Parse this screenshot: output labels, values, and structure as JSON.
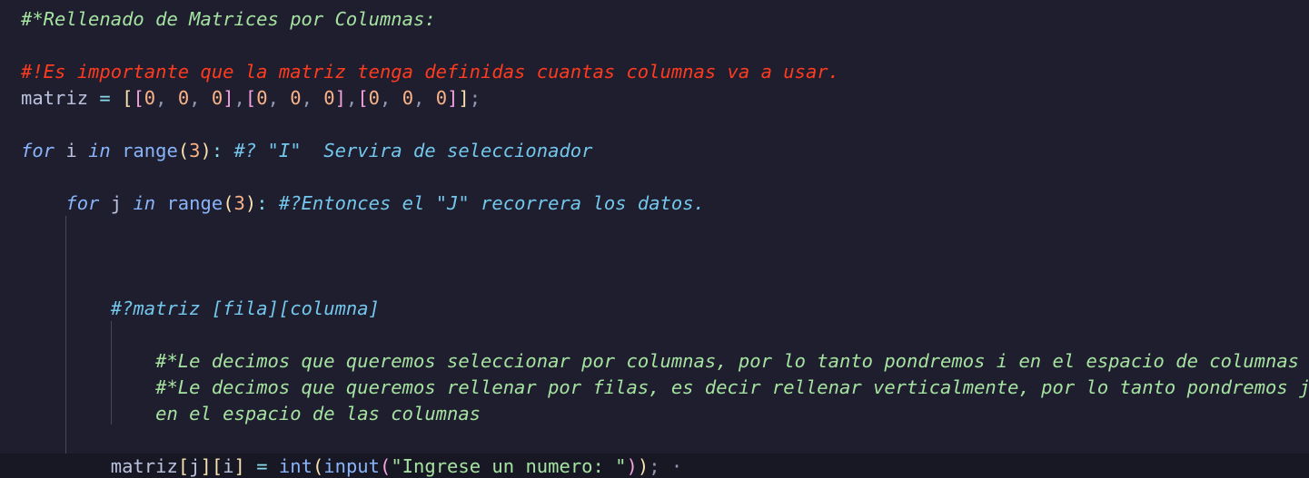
{
  "colors": {
    "background": "#1e1e2e",
    "current_line": "#181825",
    "indent_guide": "#45475a",
    "text": "#cdd6f4",
    "keyword": "#89b4fa",
    "variable": "#bac2de",
    "comment_green": "#a6e3a1",
    "comment_red": "#ff3b1f",
    "comment_blue": "#74c7ec",
    "number": "#fab387",
    "bracket_yellow": "#f9e2af",
    "bracket_pink": "#f5a3e0",
    "bracket_blue": "#89b4fa",
    "string": "#a6e3a1",
    "operator": "#89dceb",
    "function": "#89b4fa",
    "punct": "#9399b2"
  },
  "code": {
    "lines": [
      {
        "tokens": [
          {
            "t": "#*Rellenado de Matrices por Columnas:",
            "c": "comment_green",
            "i": true
          }
        ]
      },
      {
        "tokens": []
      },
      {
        "tokens": [
          {
            "t": "#!Es importante que la matriz tenga definidas cuantas columnas va a usar.",
            "c": "comment_red",
            "i": true
          }
        ]
      },
      {
        "tokens": [
          {
            "t": "matriz",
            "c": "variable"
          },
          {
            "t": " = ",
            "c": "operator"
          },
          {
            "t": "[",
            "c": "bracket_yellow"
          },
          {
            "t": "[",
            "c": "bracket_pink"
          },
          {
            "t": "0",
            "c": "number"
          },
          {
            "t": ", ",
            "c": "punct"
          },
          {
            "t": "0",
            "c": "number"
          },
          {
            "t": ", ",
            "c": "punct"
          },
          {
            "t": "0",
            "c": "number"
          },
          {
            "t": "]",
            "c": "bracket_pink"
          },
          {
            "t": ",",
            "c": "punct"
          },
          {
            "t": "[",
            "c": "bracket_pink"
          },
          {
            "t": "0",
            "c": "number"
          },
          {
            "t": ", ",
            "c": "punct"
          },
          {
            "t": "0",
            "c": "number"
          },
          {
            "t": ", ",
            "c": "punct"
          },
          {
            "t": "0",
            "c": "number"
          },
          {
            "t": "]",
            "c": "bracket_pink"
          },
          {
            "t": ",",
            "c": "punct"
          },
          {
            "t": "[",
            "c": "bracket_pink"
          },
          {
            "t": "0",
            "c": "number"
          },
          {
            "t": ", ",
            "c": "punct"
          },
          {
            "t": "0",
            "c": "number"
          },
          {
            "t": ", ",
            "c": "punct"
          },
          {
            "t": "0",
            "c": "number"
          },
          {
            "t": "]",
            "c": "bracket_pink"
          },
          {
            "t": "]",
            "c": "bracket_yellow"
          },
          {
            "t": ";",
            "c": "punct"
          }
        ]
      },
      {
        "tokens": []
      },
      {
        "tokens": [
          {
            "t": "for",
            "c": "keyword",
            "i": true
          },
          {
            "t": " i ",
            "c": "variable"
          },
          {
            "t": "in",
            "c": "keyword",
            "i": true
          },
          {
            "t": " range",
            "c": "function"
          },
          {
            "t": "(",
            "c": "bracket_yellow"
          },
          {
            "t": "3",
            "c": "number"
          },
          {
            "t": ")",
            "c": "bracket_yellow"
          },
          {
            "t": ": ",
            "c": "operator"
          },
          {
            "t": "#? \"I\"  Servira de seleccionador",
            "c": "comment_blue",
            "i": true
          }
        ]
      },
      {
        "tokens": []
      },
      {
        "tokens": [
          {
            "t": "    ",
            "c": "text"
          },
          {
            "t": "for",
            "c": "keyword",
            "i": true
          },
          {
            "t": " j ",
            "c": "variable"
          },
          {
            "t": "in",
            "c": "keyword",
            "i": true
          },
          {
            "t": " range",
            "c": "function"
          },
          {
            "t": "(",
            "c": "bracket_yellow"
          },
          {
            "t": "3",
            "c": "number"
          },
          {
            "t": ")",
            "c": "bracket_yellow"
          },
          {
            "t": ": ",
            "c": "operator"
          },
          {
            "t": "#?Entonces el \"J\" recorrera los datos.",
            "c": "comment_blue",
            "i": true
          }
        ]
      },
      {
        "tokens": []
      },
      {
        "tokens": []
      },
      {
        "tokens": []
      },
      {
        "tokens": [
          {
            "t": "        ",
            "c": "text"
          },
          {
            "t": "#?matriz [fila][columna]",
            "c": "comment_blue",
            "i": true
          }
        ]
      },
      {
        "tokens": []
      },
      {
        "tokens": [
          {
            "t": "            ",
            "c": "text"
          },
          {
            "t": "#*Le decimos que queremos seleccionar por columnas, por lo tanto pondremos i en el espacio de columnas",
            "c": "comment_green",
            "i": true
          }
        ]
      },
      {
        "tokens": [
          {
            "t": "            ",
            "c": "text"
          },
          {
            "t": "#*Le decimos que queremos rellenar por filas, es decir rellenar verticalmente, por lo tanto pondremos j",
            "c": "comment_green",
            "i": true
          }
        ]
      },
      {
        "tokens": [
          {
            "t": "            ",
            "c": "text"
          },
          {
            "t": "en el espacio de las columnas",
            "c": "comment_green",
            "i": true
          }
        ]
      },
      {
        "tokens": []
      },
      {
        "current": true,
        "tokens": [
          {
            "t": "        ",
            "c": "text"
          },
          {
            "t": "matriz",
            "c": "variable"
          },
          {
            "t": "[",
            "c": "bracket_yellow"
          },
          {
            "t": "j",
            "c": "variable"
          },
          {
            "t": "]",
            "c": "bracket_yellow"
          },
          {
            "t": "[",
            "c": "bracket_yellow"
          },
          {
            "t": "i",
            "c": "variable"
          },
          {
            "t": "]",
            "c": "bracket_yellow"
          },
          {
            "t": " = ",
            "c": "operator"
          },
          {
            "t": "int",
            "c": "function"
          },
          {
            "t": "(",
            "c": "bracket_yellow"
          },
          {
            "t": "input",
            "c": "function"
          },
          {
            "t": "(",
            "c": "bracket_pink"
          },
          {
            "t": "\"Ingrese un numero: \"",
            "c": "string"
          },
          {
            "t": ")",
            "c": "bracket_pink"
          },
          {
            "t": ")",
            "c": "bracket_yellow"
          },
          {
            "t": ";",
            "c": "punct"
          },
          {
            "t": " ·",
            "c": "punct"
          }
        ]
      }
    ]
  }
}
